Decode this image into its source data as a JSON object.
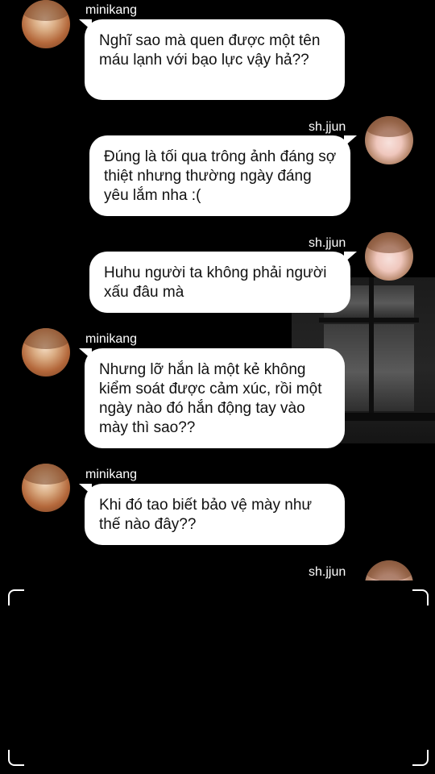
{
  "messages": [
    {
      "sender": "minikang",
      "text": "Nghĩ sao mà quen được một tên máu lạnh với bạo lực vậy hả??"
    },
    {
      "sender": "sh.jjun",
      "text": "Đúng là tối qua trông ảnh đáng sợ thiệt nhưng thường ngày đáng yêu lắm nha :("
    },
    {
      "sender": "sh.jjun",
      "text": "Huhu người ta không phải người xấu đâu mà"
    },
    {
      "sender": "minikang",
      "text": "Nhưng lỡ hắn là một kẻ không kiểm soát được cảm xúc, rồi một ngày nào đó hắn động tay vào mày thì sao??"
    },
    {
      "sender": "minikang",
      "text": "Khi đó tao biết bảo vệ mày như thế nào đây??"
    },
    {
      "sender": "sh.jjun",
      "text": ""
    }
  ],
  "colors": {
    "background": "#000000",
    "bubble": "#ffffff",
    "text": "#111111"
  }
}
